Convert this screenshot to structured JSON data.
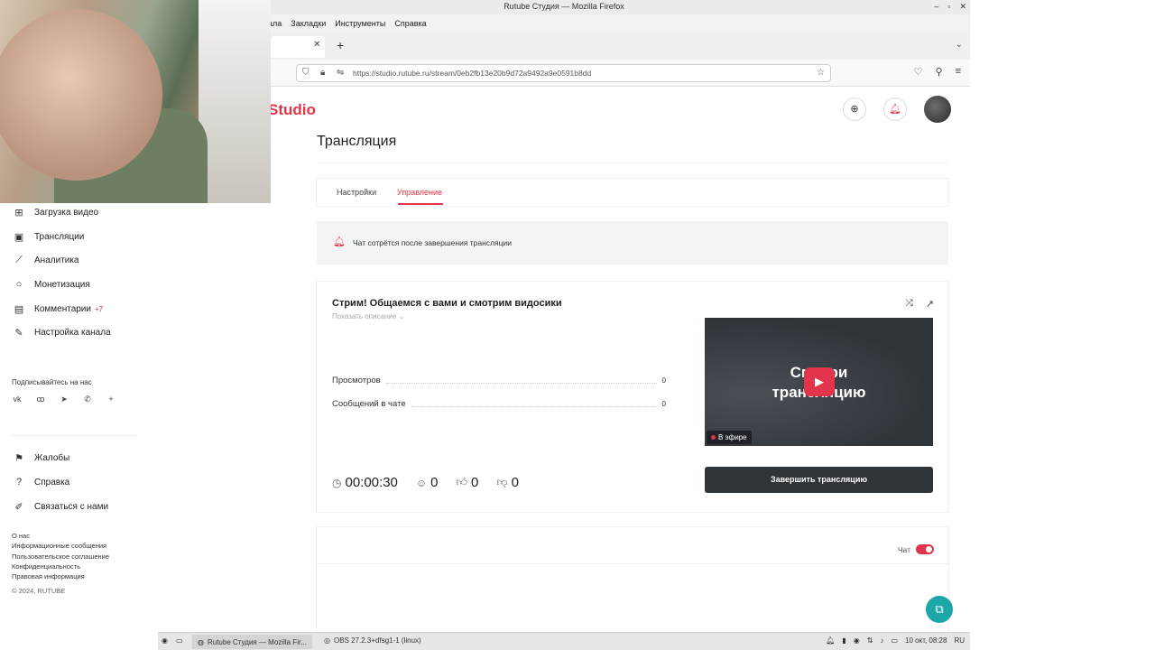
{
  "browser": {
    "window_title": "Rutube Студия — Mozilla Firefox",
    "menu": [
      "ала",
      "Закладки",
      "Инструменты",
      "Справка"
    ],
    "url": "https://studio.rutube.ru/stream/0eb2fb13e20b9d72a9492a9e0591b8dd"
  },
  "app": {
    "logo": "Studio",
    "page_title": "Трансляция",
    "tabs": [
      {
        "label": "Настройки",
        "active": false
      },
      {
        "label": "Управление",
        "active": true
      }
    ],
    "notice": "Чат сотрётся после завершения трансляции",
    "stream": {
      "title": "Стрим! Общаемся с вами и смотрим видосики",
      "show_description": "Показать описание",
      "stats": [
        {
          "label": "Просмотров",
          "value": "0"
        },
        {
          "label": "Сообщений в чате",
          "value": "0"
        }
      ],
      "timer": "00:00:30",
      "viewers": "0",
      "likes": "0",
      "dislikes": "0",
      "preview_text_line1": "Смотри",
      "preview_text_line2": "трансляцию",
      "live_badge": "В эфире",
      "end_button": "Завершить трансляцию"
    },
    "chat": {
      "label": "Чат",
      "enabled": true
    }
  },
  "sidebar": {
    "items": [
      {
        "label": "Загрузка видео",
        "icon": "upload-icon"
      },
      {
        "label": "Трансляции",
        "icon": "live-icon"
      },
      {
        "label": "Аналитика",
        "icon": "analytics-icon"
      },
      {
        "label": "Монетизация",
        "icon": "coin-icon"
      },
      {
        "label": "Комментарии",
        "icon": "comment-icon",
        "badge": "+7"
      },
      {
        "label": "Настройка канала",
        "icon": "wand-icon"
      }
    ],
    "follow_label": "Подписывайтесь на нас",
    "socials": [
      "vk",
      "ok",
      "telegram",
      "viber",
      "more"
    ],
    "bottom_items": [
      {
        "label": "Жалобы",
        "icon": "flag-icon"
      },
      {
        "label": "Справка",
        "icon": "help-icon"
      },
      {
        "label": "Связаться с нами",
        "icon": "pen-icon"
      }
    ],
    "footer_links": [
      "О нас",
      "Информационные сообщения",
      "Пользовательское соглашение",
      "Конфиденциальность",
      "Правовая информация"
    ],
    "copyright": "© 2024, RUTUBE"
  },
  "taskbar": {
    "firefox_task": "Rutube Студия — Mozilla Fir...",
    "obs_task": "OBS 27.2.3+dfsg1-1 (linux)",
    "clock": "10 окт, 08:28",
    "lang": "RU"
  },
  "colors": {
    "accent": "#e2344a",
    "dark": "#2f3439",
    "help": "#1da6a8"
  }
}
